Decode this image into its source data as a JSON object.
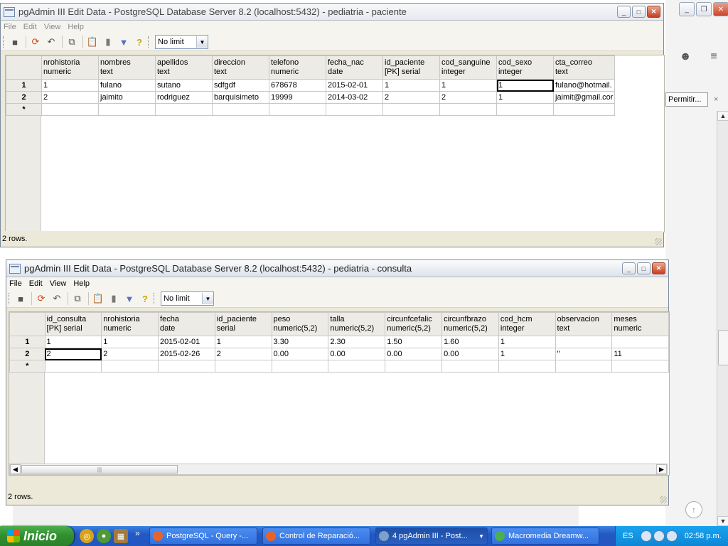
{
  "background": {
    "permit_button": "Permitir...",
    "close_x": "×"
  },
  "window1": {
    "title": "pgAdmin III Edit Data - PostgreSQL Database Server 8.2 (localhost:5432) - pediatria - paciente",
    "menu": [
      "File",
      "Edit",
      "View",
      "Help"
    ],
    "limit": "No limit",
    "columns": [
      {
        "name": "nrohistoria",
        "type": "numeric"
      },
      {
        "name": "nombres",
        "type": "text"
      },
      {
        "name": "apellidos",
        "type": "text"
      },
      {
        "name": "direccion",
        "type": "text"
      },
      {
        "name": "telefono",
        "type": "numeric"
      },
      {
        "name": "fecha_nac",
        "type": "date"
      },
      {
        "name": "id_paciente",
        "type": "[PK] serial"
      },
      {
        "name": "cod_sanguine",
        "type": "integer"
      },
      {
        "name": "cod_sexo",
        "type": "integer"
      },
      {
        "name": "cta_correo",
        "type": "text"
      }
    ],
    "rows": [
      {
        "num": "1",
        "cells": [
          "1",
          "fulano",
          "sutano",
          "sdfgdf",
          "678678",
          "2015-02-01",
          "1",
          "1",
          "1",
          "fulano@hotmail."
        ]
      },
      {
        "num": "2",
        "cells": [
          "2",
          "jaimito",
          "rodriguez",
          "barquisimeto",
          "19999",
          "2014-03-02",
          "2",
          "2",
          "1",
          "jaimit@gmail.cor"
        ]
      }
    ],
    "new_row_marker": "*",
    "status": "2 rows."
  },
  "window2": {
    "title": "pgAdmin III Edit Data - PostgreSQL Database Server 8.2 (localhost:5432) - pediatria - consulta",
    "menu": [
      "File",
      "Edit",
      "View",
      "Help"
    ],
    "limit": "No limit",
    "columns": [
      {
        "name": "id_consulta",
        "type": "[PK] serial"
      },
      {
        "name": "nrohistoria",
        "type": "numeric"
      },
      {
        "name": "fecha",
        "type": "date"
      },
      {
        "name": "id_paciente",
        "type": "serial"
      },
      {
        "name": "peso",
        "type": "numeric(5,2)"
      },
      {
        "name": "talla",
        "type": "numeric(5,2)"
      },
      {
        "name": "circunfcefalic",
        "type": "numeric(5,2)"
      },
      {
        "name": "circunfbrazo",
        "type": "numeric(5,2)"
      },
      {
        "name": "cod_hcm",
        "type": "integer"
      },
      {
        "name": "observacion",
        "type": "text"
      },
      {
        "name": "meses",
        "type": "numeric"
      }
    ],
    "rows": [
      {
        "num": "1",
        "cells": [
          "1",
          "1",
          "2015-02-01",
          "1",
          "3.30",
          "2.30",
          "1.50",
          "1.60",
          "1",
          "",
          ""
        ]
      },
      {
        "num": "2",
        "cells": [
          "2",
          "2",
          "2015-02-26",
          "2",
          "0.00",
          "0.00",
          "0.00",
          "0.00",
          "1",
          "''",
          "11"
        ]
      }
    ],
    "new_row_marker": "*",
    "status": "2 rows."
  },
  "taskbar": {
    "start_label": "Inicio",
    "tasks": [
      {
        "label": "PostgreSQL - Query -...",
        "icon_color": "#e8632b"
      },
      {
        "label": "Control de Reparació...",
        "icon_color": "#e8632b"
      },
      {
        "label": "4 pgAdmin III - Post...",
        "icon_color": "#7fa0c8"
      },
      {
        "label": "Macromedia Dreamw...",
        "icon_color": "#4caf50"
      }
    ],
    "language": "ES",
    "clock": "02:58 p.m."
  }
}
